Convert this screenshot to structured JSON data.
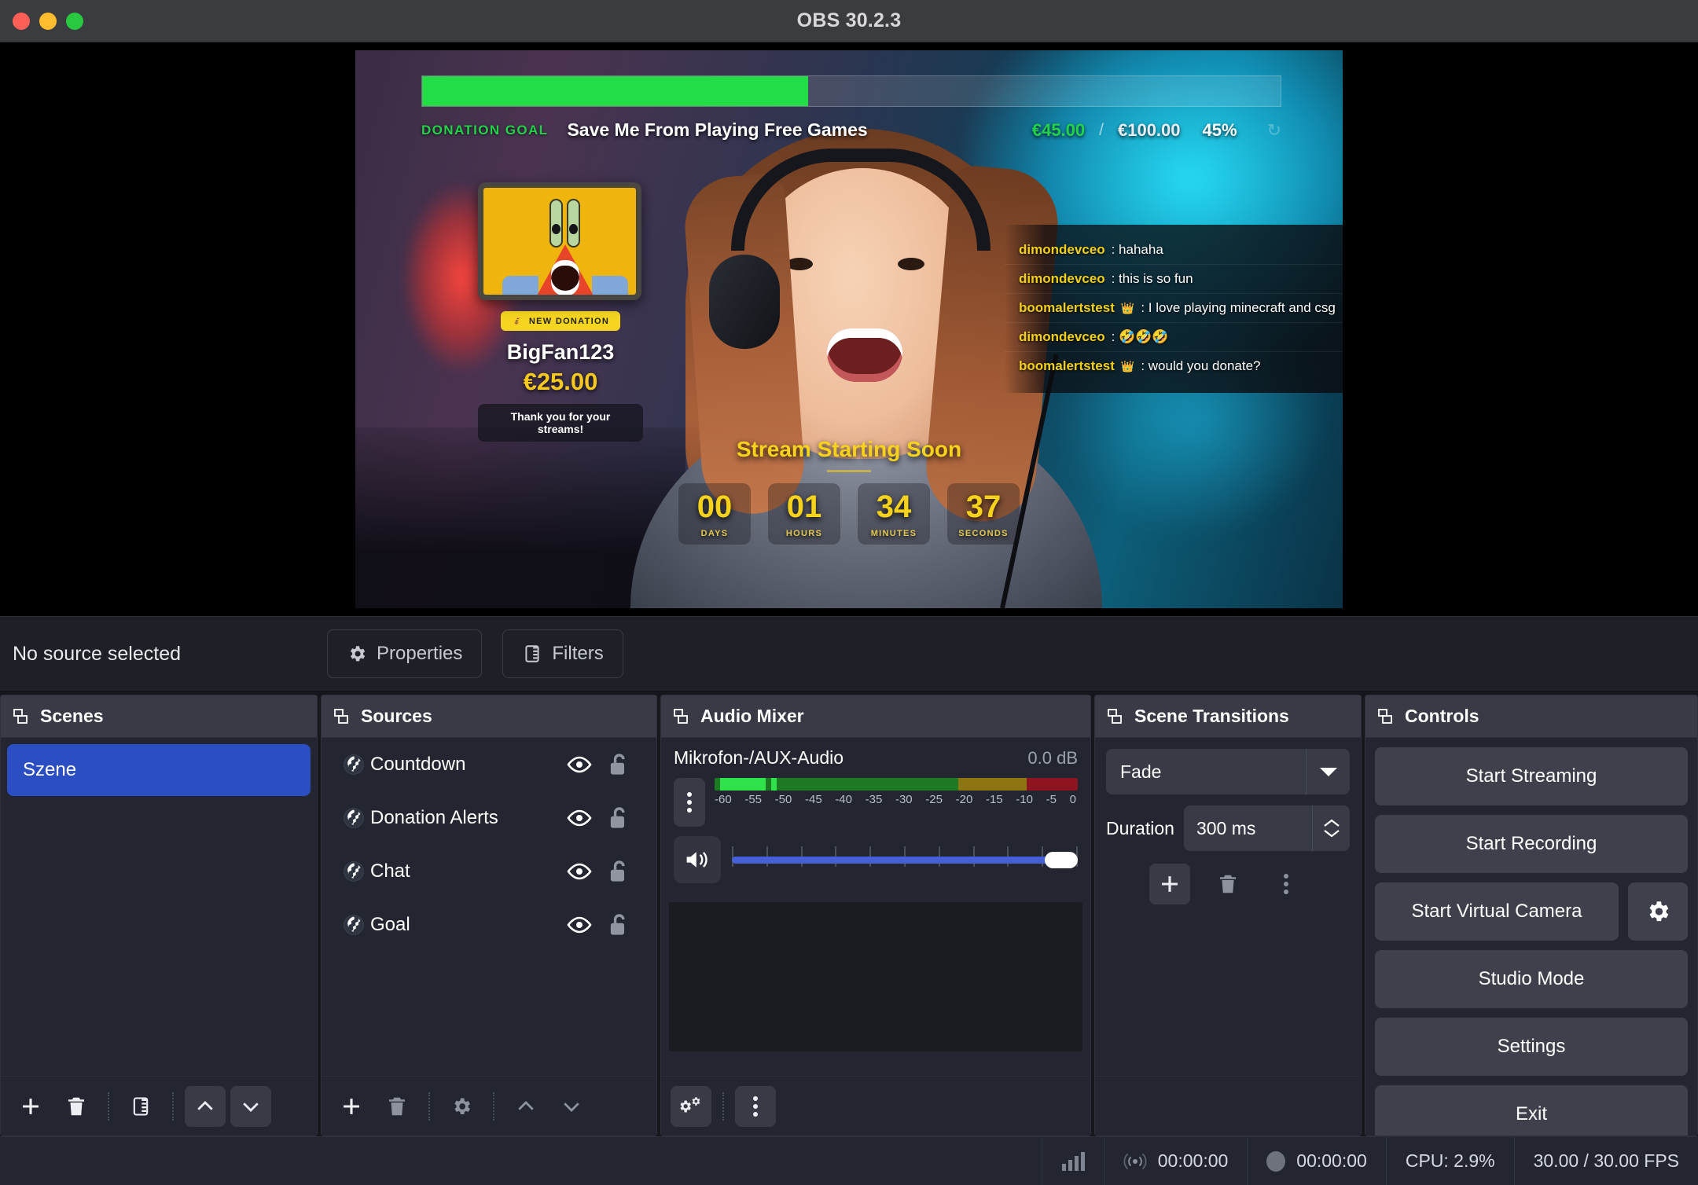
{
  "window": {
    "title": "OBS 30.2.3"
  },
  "preview": {
    "goal": {
      "label": "DONATION GOAL",
      "title": "Save Me From Playing Free Games",
      "current": "€45.00",
      "separator": "/",
      "target": "€100.00",
      "percent_text": "45%",
      "percent_value": 45,
      "bar_color": "#23dd48",
      "reset_icon": "reset-icon"
    },
    "alert": {
      "badge_icon": "money-bag-icon",
      "badge_label": "NEW DONATION",
      "username": "BigFan123",
      "amount": "€25.00",
      "message": "Thank you for your streams!"
    },
    "chat": {
      "messages": [
        {
          "user": "dimondevceo",
          "badge": "",
          "colon": ":",
          "text": "hahaha"
        },
        {
          "user": "dimondevceo",
          "badge": "",
          "colon": ":",
          "text": "this is so fun"
        },
        {
          "user": "boomalertstest",
          "badge": "👑",
          "colon": ":",
          "text": "I love playing minecraft and csg"
        },
        {
          "user": "dimondevceo",
          "badge": "",
          "colon": ":",
          "text": "🤣🤣🤣"
        },
        {
          "user": "boomalertstest",
          "badge": "👑",
          "colon": ":",
          "text": "would you donate?"
        }
      ]
    },
    "countdown": {
      "title": "Stream Starting Soon",
      "units": [
        {
          "value": "00",
          "label": "DAYS"
        },
        {
          "value": "01",
          "label": "HOURS"
        },
        {
          "value": "34",
          "label": "MINUTES"
        },
        {
          "value": "37",
          "label": "SECONDS"
        }
      ]
    }
  },
  "sourcebar": {
    "status": "No source selected",
    "properties_label": "Properties",
    "properties_icon": "gear-icon",
    "filters_label": "Filters",
    "filters_icon": "filters-icon"
  },
  "scenes": {
    "title": "Scenes",
    "items": [
      {
        "name": "Szene",
        "selected": true
      }
    ],
    "toolbar": [
      "add-icon",
      "remove-icon",
      "scene-filters-icon",
      "move-up-icon",
      "move-down-icon"
    ]
  },
  "sources": {
    "title": "Sources",
    "items": [
      {
        "name": "Countdown",
        "type_icon": "browser-source-icon",
        "visible": true,
        "locked": false
      },
      {
        "name": "Donation Alerts",
        "type_icon": "browser-source-icon",
        "visible": true,
        "locked": false
      },
      {
        "name": "Chat",
        "type_icon": "browser-source-icon",
        "visible": true,
        "locked": false
      },
      {
        "name": "Goal",
        "type_icon": "browser-source-icon",
        "visible": true,
        "locked": false
      }
    ],
    "toolbar": [
      "add-icon",
      "remove-icon",
      "properties-gear-icon",
      "move-up-icon",
      "move-down-icon"
    ]
  },
  "audio_mixer": {
    "title": "Audio Mixer",
    "channel_name": "Mikrofon-/AUX-Audio",
    "db_value": "0.0 dB",
    "scale_ticks": [
      "-60",
      "-55",
      "-50",
      "-45",
      "-40",
      "-35",
      "-30",
      "-25",
      "-20",
      "-15",
      "-10",
      "-5",
      "0"
    ],
    "volume_percent": 100,
    "toolbar": [
      "advanced-audio-properties-icon",
      "audio-menu-icon"
    ]
  },
  "scene_transitions": {
    "title": "Scene Transitions",
    "transition": "Fade",
    "duration_label": "Duration",
    "duration_value": "300 ms",
    "toolbar": [
      "add-transition-icon",
      "remove-transition-icon",
      "transition-menu-icon"
    ]
  },
  "controls": {
    "title": "Controls",
    "buttons": [
      {
        "label": "Start Streaming"
      },
      {
        "label": "Start Recording"
      },
      {
        "label": "Start Virtual Camera",
        "gear": true
      },
      {
        "label": "Studio Mode"
      },
      {
        "label": "Settings"
      },
      {
        "label": "Exit"
      }
    ]
  },
  "statusbar": {
    "signal_icon": "signal-bars-icon",
    "stream_icon": "broadcast-icon",
    "stream_time": "00:00:00",
    "record_icon": "record-dot-icon",
    "record_time": "00:00:00",
    "cpu": "CPU: 2.9%",
    "fps": "30.00 / 30.00 FPS"
  }
}
